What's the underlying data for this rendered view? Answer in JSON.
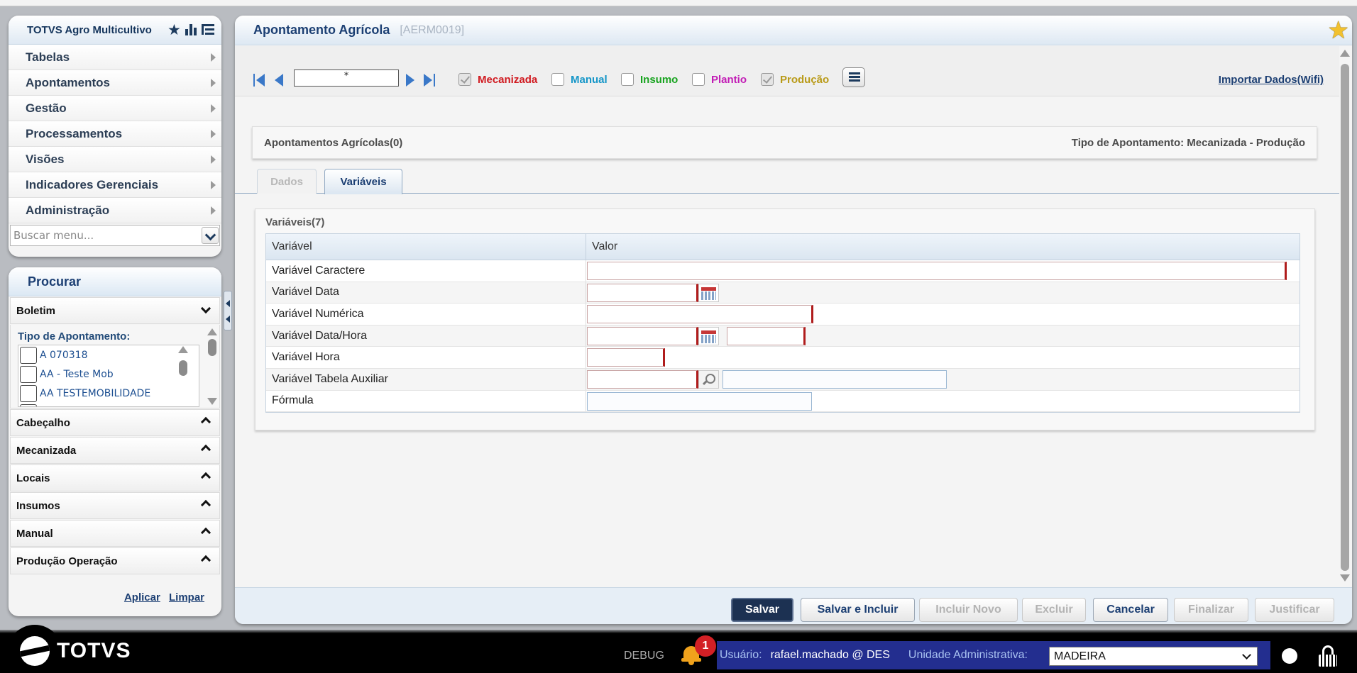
{
  "sidebar": {
    "app_title": "TOTVS Agro Multicultivo",
    "menu_items": [
      "Tabelas",
      "Apontamentos",
      "Gestão",
      "Processamentos",
      "Visões",
      "Indicadores Gerenciais",
      "Administração"
    ],
    "search_placeholder": "Buscar menu..."
  },
  "search_panel": {
    "title": "Procurar",
    "boletim_label": "Boletim",
    "tipo_label": "Tipo de Apontamento:",
    "tipo_options": [
      "A 070318",
      "AA - Teste Mob",
      "AA TESTEMOBILIDADE"
    ],
    "sections": [
      "Cabeçalho",
      "Mecanizada",
      "Locais",
      "Insumos",
      "Manual",
      "Produção Operação"
    ],
    "apply_link": "Aplicar",
    "clear_link": "Limpar"
  },
  "main": {
    "title": "Apontamento Agrícola",
    "code": "[AERM0019]",
    "record_field": "*",
    "flags": [
      {
        "label": "Mecanizada",
        "checked": true,
        "color": "#d0191f"
      },
      {
        "label": "Manual",
        "checked": false,
        "color": "#1596c8"
      },
      {
        "label": "Insumo",
        "checked": false,
        "color": "#18a31f"
      },
      {
        "label": "Plantio",
        "checked": false,
        "color": "#c21cb5"
      },
      {
        "label": "Produção",
        "checked": true,
        "color": "#b99a17"
      }
    ],
    "import_link": "Importar Dados(Wifi)",
    "records_label": "Apontamentos Agrícolas(0)",
    "tipo_info": "Tipo de Apontamento: Mecanizada - Produção",
    "tabs": [
      "Dados",
      "Variáveis"
    ],
    "active_tab": "Variáveis",
    "vars_title": "Variáveis(7)",
    "columns": [
      "Variável",
      "Valor"
    ],
    "rows": [
      "Variável Caractere",
      "Variável Data",
      "Variável Numérica",
      "Variável Data/Hora",
      "Variável Hora",
      "Variável Tabela Auxiliar",
      "Fórmula"
    ],
    "buttons": {
      "save": "Salvar",
      "save_include": "Salvar e Incluir",
      "include_new": "Incluir Novo",
      "delete": "Excluir",
      "cancel": "Cancelar",
      "finish": "Finalizar",
      "justify": "Justificar"
    }
  },
  "footer": {
    "logo_text": "TOTVS",
    "debug": "DEBUG",
    "notification_count": "1",
    "user_label": "Usuário:",
    "user_value": "rafael.machado @ DES",
    "unit_label": "Unidade Administrativa:",
    "unit_value": "MADEIRA"
  },
  "icons": [
    "star-icon",
    "chart-bars-icon",
    "tree-menu-icon",
    "chevron-right-icon",
    "chevron-down-icon",
    "chevron-up-icon",
    "first-record-icon",
    "prev-record-icon",
    "next-record-icon",
    "last-record-icon",
    "list-icon",
    "favorite-star-icon",
    "calendar-icon",
    "magnifier-icon",
    "bell-icon",
    "lock-icon"
  ]
}
